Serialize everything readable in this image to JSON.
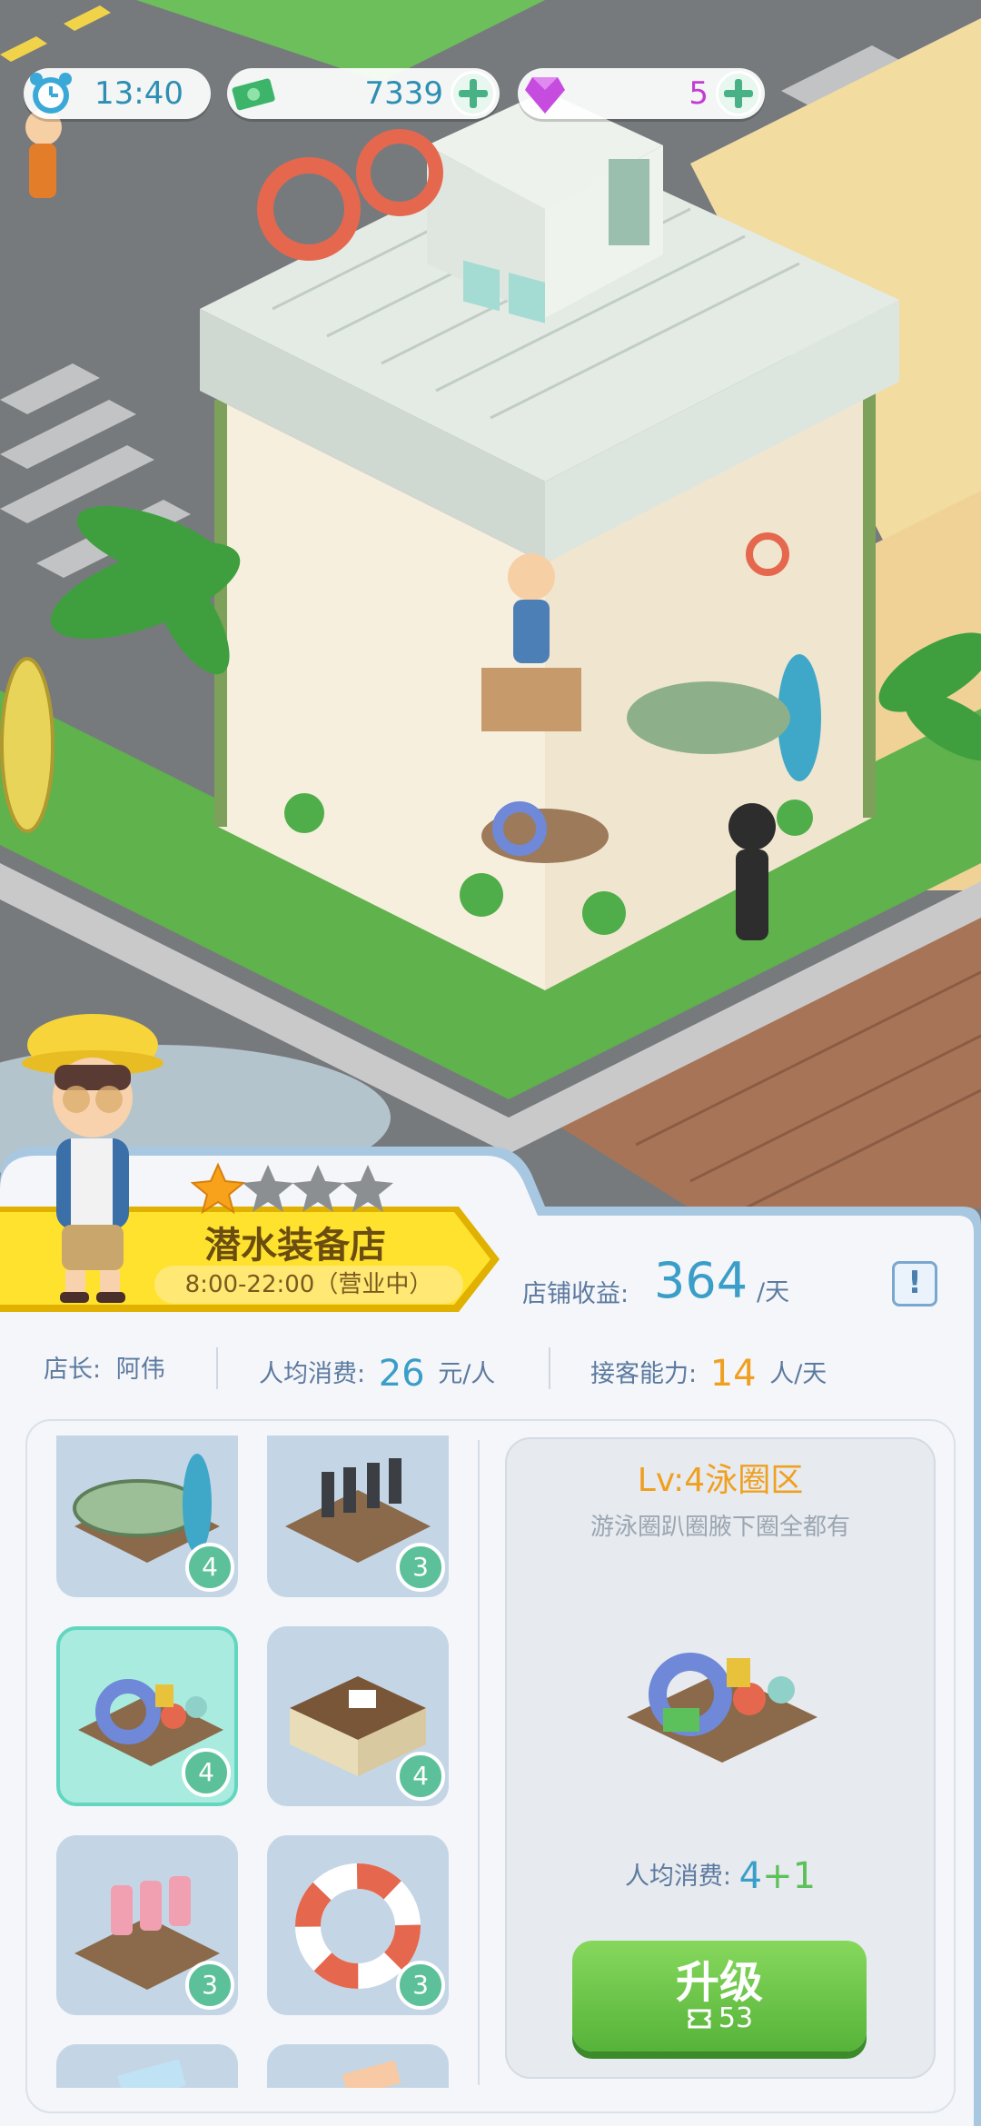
{
  "hud": {
    "time": "13:40",
    "money": "7339",
    "gems": "5"
  },
  "shop": {
    "name": "潜水装备店",
    "hours": "8:00-22:00（营业中）",
    "stars_filled": 1,
    "stars_total": 4,
    "income_label": "店铺收益:",
    "income_value": "364",
    "income_unit": "/天",
    "info_label": "!"
  },
  "stats": {
    "owner_label": "店长:",
    "owner_name": "阿伟",
    "spend_label": "人均消费:",
    "spend_value": "26",
    "spend_unit": "元/人",
    "capacity_label": "接客能力:",
    "capacity_value": "14",
    "capacity_unit": "人/天"
  },
  "facilities": [
    {
      "icon": "surfboard-rack-icon",
      "level": "4"
    },
    {
      "icon": "fin-rack-icon",
      "level": "3"
    },
    {
      "icon": "swim-ring-stand-icon",
      "level": "4",
      "selected": true
    },
    {
      "icon": "counter-icon",
      "level": "4"
    },
    {
      "icon": "wetsuit-rack-icon",
      "level": "3"
    },
    {
      "icon": "lifebuoy-icon",
      "level": "3"
    },
    {
      "icon": "towel-icon",
      "level": ""
    },
    {
      "icon": "item-icon",
      "level": ""
    }
  ],
  "detail": {
    "title": "Lv:4泳圈区",
    "description": "游泳圈趴圈腋下圈全都有",
    "spend_label": "人均消费:",
    "spend_base": "4",
    "spend_bonus": "+1",
    "upgrade_label": "升级",
    "upgrade_cost": "53"
  },
  "colors": {
    "accent_blue": "#3a9ec8",
    "accent_orange": "#f0a020",
    "accent_green": "#5cc15a",
    "selected_tile": "#a9ecdf"
  }
}
